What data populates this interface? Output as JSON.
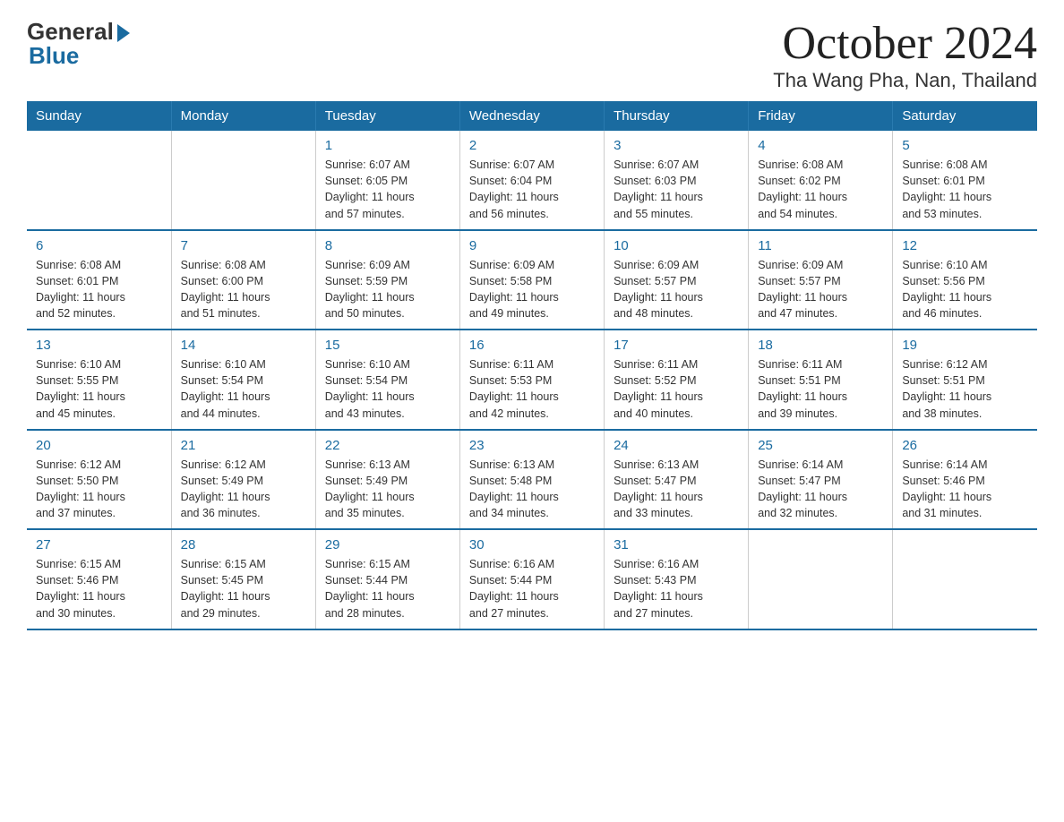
{
  "logo": {
    "general": "General",
    "blue": "Blue"
  },
  "title": "October 2024",
  "subtitle": "Tha Wang Pha, Nan, Thailand",
  "days_header": [
    "Sunday",
    "Monday",
    "Tuesday",
    "Wednesday",
    "Thursday",
    "Friday",
    "Saturday"
  ],
  "weeks": [
    [
      {
        "num": "",
        "info": ""
      },
      {
        "num": "",
        "info": ""
      },
      {
        "num": "1",
        "info": "Sunrise: 6:07 AM\nSunset: 6:05 PM\nDaylight: 11 hours\nand 57 minutes."
      },
      {
        "num": "2",
        "info": "Sunrise: 6:07 AM\nSunset: 6:04 PM\nDaylight: 11 hours\nand 56 minutes."
      },
      {
        "num": "3",
        "info": "Sunrise: 6:07 AM\nSunset: 6:03 PM\nDaylight: 11 hours\nand 55 minutes."
      },
      {
        "num": "4",
        "info": "Sunrise: 6:08 AM\nSunset: 6:02 PM\nDaylight: 11 hours\nand 54 minutes."
      },
      {
        "num": "5",
        "info": "Sunrise: 6:08 AM\nSunset: 6:01 PM\nDaylight: 11 hours\nand 53 minutes."
      }
    ],
    [
      {
        "num": "6",
        "info": "Sunrise: 6:08 AM\nSunset: 6:01 PM\nDaylight: 11 hours\nand 52 minutes."
      },
      {
        "num": "7",
        "info": "Sunrise: 6:08 AM\nSunset: 6:00 PM\nDaylight: 11 hours\nand 51 minutes."
      },
      {
        "num": "8",
        "info": "Sunrise: 6:09 AM\nSunset: 5:59 PM\nDaylight: 11 hours\nand 50 minutes."
      },
      {
        "num": "9",
        "info": "Sunrise: 6:09 AM\nSunset: 5:58 PM\nDaylight: 11 hours\nand 49 minutes."
      },
      {
        "num": "10",
        "info": "Sunrise: 6:09 AM\nSunset: 5:57 PM\nDaylight: 11 hours\nand 48 minutes."
      },
      {
        "num": "11",
        "info": "Sunrise: 6:09 AM\nSunset: 5:57 PM\nDaylight: 11 hours\nand 47 minutes."
      },
      {
        "num": "12",
        "info": "Sunrise: 6:10 AM\nSunset: 5:56 PM\nDaylight: 11 hours\nand 46 minutes."
      }
    ],
    [
      {
        "num": "13",
        "info": "Sunrise: 6:10 AM\nSunset: 5:55 PM\nDaylight: 11 hours\nand 45 minutes."
      },
      {
        "num": "14",
        "info": "Sunrise: 6:10 AM\nSunset: 5:54 PM\nDaylight: 11 hours\nand 44 minutes."
      },
      {
        "num": "15",
        "info": "Sunrise: 6:10 AM\nSunset: 5:54 PM\nDaylight: 11 hours\nand 43 minutes."
      },
      {
        "num": "16",
        "info": "Sunrise: 6:11 AM\nSunset: 5:53 PM\nDaylight: 11 hours\nand 42 minutes."
      },
      {
        "num": "17",
        "info": "Sunrise: 6:11 AM\nSunset: 5:52 PM\nDaylight: 11 hours\nand 40 minutes."
      },
      {
        "num": "18",
        "info": "Sunrise: 6:11 AM\nSunset: 5:51 PM\nDaylight: 11 hours\nand 39 minutes."
      },
      {
        "num": "19",
        "info": "Sunrise: 6:12 AM\nSunset: 5:51 PM\nDaylight: 11 hours\nand 38 minutes."
      }
    ],
    [
      {
        "num": "20",
        "info": "Sunrise: 6:12 AM\nSunset: 5:50 PM\nDaylight: 11 hours\nand 37 minutes."
      },
      {
        "num": "21",
        "info": "Sunrise: 6:12 AM\nSunset: 5:49 PM\nDaylight: 11 hours\nand 36 minutes."
      },
      {
        "num": "22",
        "info": "Sunrise: 6:13 AM\nSunset: 5:49 PM\nDaylight: 11 hours\nand 35 minutes."
      },
      {
        "num": "23",
        "info": "Sunrise: 6:13 AM\nSunset: 5:48 PM\nDaylight: 11 hours\nand 34 minutes."
      },
      {
        "num": "24",
        "info": "Sunrise: 6:13 AM\nSunset: 5:47 PM\nDaylight: 11 hours\nand 33 minutes."
      },
      {
        "num": "25",
        "info": "Sunrise: 6:14 AM\nSunset: 5:47 PM\nDaylight: 11 hours\nand 32 minutes."
      },
      {
        "num": "26",
        "info": "Sunrise: 6:14 AM\nSunset: 5:46 PM\nDaylight: 11 hours\nand 31 minutes."
      }
    ],
    [
      {
        "num": "27",
        "info": "Sunrise: 6:15 AM\nSunset: 5:46 PM\nDaylight: 11 hours\nand 30 minutes."
      },
      {
        "num": "28",
        "info": "Sunrise: 6:15 AM\nSunset: 5:45 PM\nDaylight: 11 hours\nand 29 minutes."
      },
      {
        "num": "29",
        "info": "Sunrise: 6:15 AM\nSunset: 5:44 PM\nDaylight: 11 hours\nand 28 minutes."
      },
      {
        "num": "30",
        "info": "Sunrise: 6:16 AM\nSunset: 5:44 PM\nDaylight: 11 hours\nand 27 minutes."
      },
      {
        "num": "31",
        "info": "Sunrise: 6:16 AM\nSunset: 5:43 PM\nDaylight: 11 hours\nand 27 minutes."
      },
      {
        "num": "",
        "info": ""
      },
      {
        "num": "",
        "info": ""
      }
    ]
  ]
}
